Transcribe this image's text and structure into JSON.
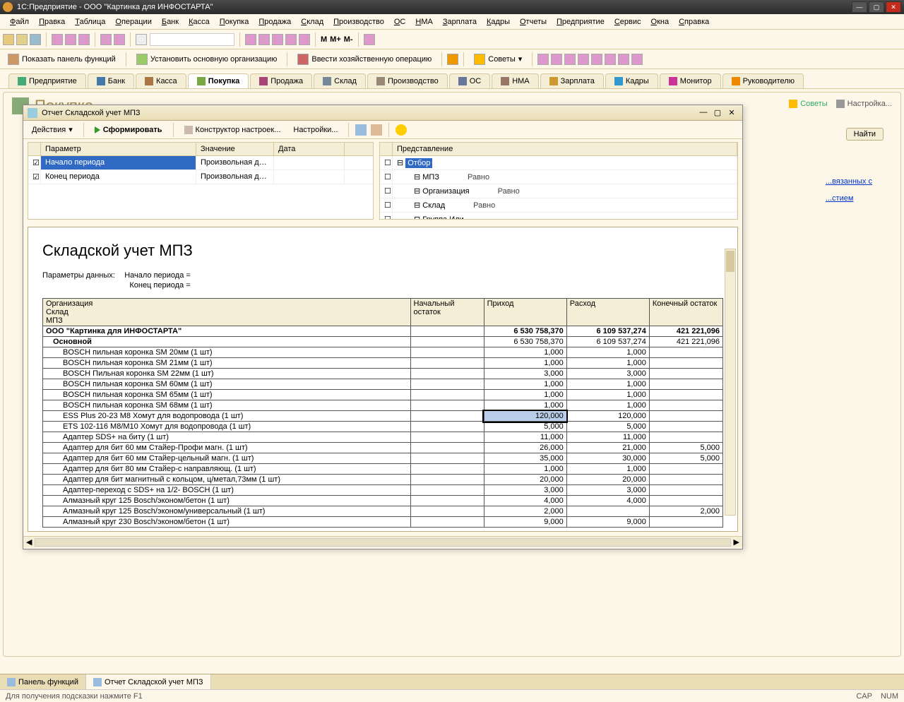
{
  "app_title": "1С:Предприятие - ООО \"Картинка для ИНФОСТАРТА\"",
  "main_menu": [
    "Файл",
    "Правка",
    "Таблица",
    "Операции",
    "Банк",
    "Касса",
    "Покупка",
    "Продажа",
    "Склад",
    "Производство",
    "ОС",
    "НМА",
    "Зарплата",
    "Кадры",
    "Отчеты",
    "Предприятие",
    "Сервис",
    "Окна",
    "Справка"
  ],
  "toolbar2": {
    "show_panel": "Показать панель функций",
    "set_org": "Установить основную организацию",
    "enter_op": "Ввести хозяйственную операцию",
    "sovety": "Советы"
  },
  "nav_tabs": [
    "Предприятие",
    "Банк",
    "Касса",
    "Покупка",
    "Продажа",
    "Склад",
    "Производство",
    "ОС",
    "НМА",
    "Зарплата",
    "Кадры",
    "Монитор",
    "Руководителю"
  ],
  "nav_active": 3,
  "page": {
    "title": "Покупка",
    "right_sovety": "Советы",
    "right_nastroyka": "Настройка...",
    "btn_find": "Найти",
    "link1": "...вязанных с",
    "link2": "...стием"
  },
  "report_window": {
    "title": "Отчет  Складской учет МПЗ",
    "toolbar": {
      "actions": "Действия",
      "form": "Сформировать",
      "constructor": "Конструктор настроек...",
      "settings": "Настройки..."
    },
    "left_filter": {
      "headers": [
        "",
        "Параметр",
        "Значение",
        "Дата"
      ],
      "rows": [
        {
          "checked": true,
          "param": "Начало периода",
          "value": "Произвольная дата",
          "date": "",
          "selected": true
        },
        {
          "checked": true,
          "param": "Конец периода",
          "value": "Произвольная дата",
          "date": "",
          "selected": false
        }
      ]
    },
    "right_filter": {
      "headers": [
        "",
        "Представление"
      ],
      "rows": [
        {
          "checked": false,
          "label": "Отбор",
          "indent": 0,
          "bold": true,
          "selected": true
        },
        {
          "checked": false,
          "label": "МПЗ",
          "indent": 1,
          "extra": "Равно"
        },
        {
          "checked": false,
          "label": "Организация",
          "indent": 1,
          "extra": "Равно"
        },
        {
          "checked": false,
          "label": "Склад",
          "indent": 1,
          "extra": "Равно"
        },
        {
          "checked": false,
          "label": "Группа Или",
          "indent": 1,
          "extra": ""
        }
      ]
    },
    "report": {
      "title": "Складской учет МПЗ",
      "params_label": "Параметры данных:",
      "params_lines": [
        "Начало периода =",
        "Конец периода ="
      ],
      "headers_top": [
        "Организация",
        "Начальный остаток",
        "Приход",
        "Расход",
        "Конечный остаток"
      ],
      "headers_sub": [
        "Склад",
        "МПЗ"
      ],
      "rows": [
        {
          "level": 0,
          "label": "ООО \"Картинка для ИНФОСТАРТА\"",
          "initial": "",
          "incoming": "6 530 758,370",
          "outgoing": "6 109 537,274",
          "final": "421 221,096"
        },
        {
          "level": 1,
          "label": "Основной",
          "initial": "",
          "incoming": "6 530 758,370",
          "outgoing": "6 109 537,274",
          "final": "421 221,096"
        },
        {
          "level": 2,
          "label": "BOSCH пильная коронка SM 20мм (1 шт)",
          "initial": "",
          "incoming": "1,000",
          "outgoing": "1,000",
          "final": ""
        },
        {
          "level": 2,
          "label": "BOSCH пильная коронка SM 21мм (1 шт)",
          "initial": "",
          "incoming": "1,000",
          "outgoing": "1,000",
          "final": ""
        },
        {
          "level": 2,
          "label": "BOSCH Пильная коронка SM 22мм (1 шт)",
          "initial": "",
          "incoming": "3,000",
          "outgoing": "3,000",
          "final": ""
        },
        {
          "level": 2,
          "label": "BOSCH пильная коронка SM 60мм (1 шт)",
          "initial": "",
          "incoming": "1,000",
          "outgoing": "1,000",
          "final": ""
        },
        {
          "level": 2,
          "label": "BOSCH пильная коронка SM 65мм (1 шт)",
          "initial": "",
          "incoming": "1,000",
          "outgoing": "1,000",
          "final": ""
        },
        {
          "level": 2,
          "label": "BOSCH пильная коронка SM 68мм (1 шт)",
          "initial": "",
          "incoming": "1,000",
          "outgoing": "1,000",
          "final": ""
        },
        {
          "level": 2,
          "label": "ESS Plus 20-23 M8 Хомут для водопровода    (1 шт)",
          "initial": "",
          "incoming": "120,000",
          "outgoing": "120,000",
          "final": "",
          "selected": "incoming"
        },
        {
          "level": 2,
          "label": "ETS 102-116 М8/М10  Хомут для водопровода    (1 шт)",
          "initial": "",
          "incoming": "5,000",
          "outgoing": "5,000",
          "final": ""
        },
        {
          "level": 2,
          "label": "Адаптер SDS+ на биту       (1 шт)",
          "initial": "",
          "incoming": "11,000",
          "outgoing": "11,000",
          "final": ""
        },
        {
          "level": 2,
          "label": "Адаптер для бит 60 мм Стайер-Профи магн.   (1 шт)",
          "initial": "",
          "incoming": "26,000",
          "outgoing": "21,000",
          "final": "5,000"
        },
        {
          "level": 2,
          "label": "Адаптер для бит 60 мм Стайер-цельный магн.  (1 шт)",
          "initial": "",
          "incoming": "35,000",
          "outgoing": "30,000",
          "final": "5,000"
        },
        {
          "level": 2,
          "label": "Адаптер для бит 80 мм Стайер-с направляющ.  (1 шт)",
          "initial": "",
          "incoming": "1,000",
          "outgoing": "1,000",
          "final": ""
        },
        {
          "level": 2,
          "label": "Адаптер для бит магнитный с кольцом, ц/метал,73мм (1 шт)",
          "initial": "",
          "incoming": "20,000",
          "outgoing": "20,000",
          "final": ""
        },
        {
          "level": 2,
          "label": "Адаптер-переход с SDS+ на 1/2- BOSCH       (1 шт)",
          "initial": "",
          "incoming": "3,000",
          "outgoing": "3,000",
          "final": ""
        },
        {
          "level": 2,
          "label": "Алмазный круг 125 Bosch/эконом/бетон  (1 шт)",
          "initial": "",
          "incoming": "4,000",
          "outgoing": "4,000",
          "final": ""
        },
        {
          "level": 2,
          "label": "Алмазный круг 125 Bosch/эконом/универсальный (1 шт)",
          "initial": "",
          "incoming": "2,000",
          "outgoing": "",
          "final": "2,000"
        },
        {
          "level": 2,
          "label": "Алмазный круг 230 Bosch/эконом/бетон (1 шт)",
          "initial": "",
          "incoming": "9,000",
          "outgoing": "9,000",
          "final": ""
        }
      ]
    }
  },
  "footer_tabs": [
    {
      "label": "Панель функций",
      "active": false
    },
    {
      "label": "Отчет  Складской учет МПЗ",
      "active": true
    }
  ],
  "status": {
    "hint": "Для получения подсказки нажмите F1",
    "caps": "CAP",
    "num": "NUM"
  }
}
